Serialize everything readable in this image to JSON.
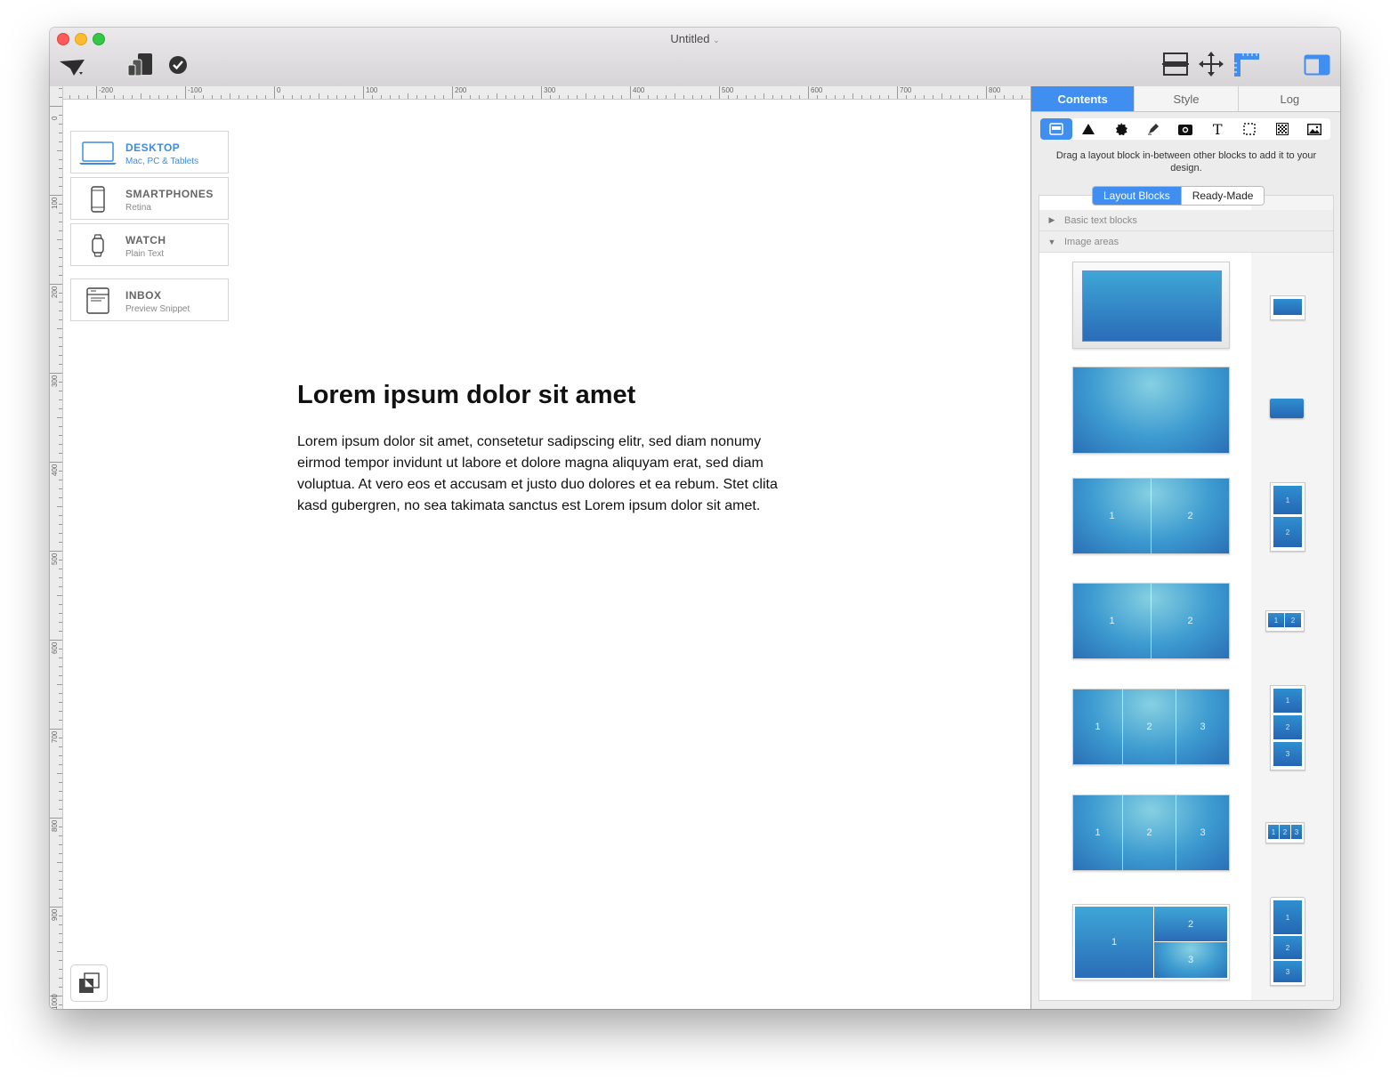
{
  "window": {
    "title": "Untitled"
  },
  "rulers": {
    "top_ticks": [
      "-200",
      "-100",
      "0",
      "100",
      "200",
      "300",
      "400",
      "500",
      "600",
      "700",
      "800"
    ],
    "left_ticks": [
      "0",
      "100",
      "200",
      "300",
      "400",
      "500",
      "600",
      "700",
      "800",
      "900",
      "1000"
    ]
  },
  "devices": [
    {
      "title": "DESKTOP",
      "subtitle": "Mac, PC & Tablets"
    },
    {
      "title": "SMARTPHONES",
      "subtitle": "Retina"
    },
    {
      "title": "WATCH",
      "subtitle": "Plain Text"
    },
    {
      "title": "INBOX",
      "subtitle": "Preview Snippet"
    }
  ],
  "document": {
    "heading": "Lorem ipsum dolor sit amet",
    "body": "Lorem ipsum dolor sit amet, consetetur sadipscing elitr, sed diam nonumy eirmod tempor invidunt ut labore et dolore magna aliquyam erat, sed diam voluptua. At vero eos et accusam et justo duo dolores et ea rebum. Stet clita kasd gubergren, no sea takimata sanctus est Lorem ipsum dolor sit amet."
  },
  "panel": {
    "tabs": [
      "Contents",
      "Style",
      "Log"
    ],
    "hint": "Drag a layout block in-between other blocks to add it to your design.",
    "segments": [
      "Layout Blocks",
      "Ready-Made"
    ],
    "groups": [
      "Basic text blocks",
      "Image areas"
    ],
    "cell_labels": {
      "one": "1",
      "two": "2",
      "three": "3"
    }
  },
  "icons": {
    "toolbar": [
      "send-icon",
      "devices-icon",
      "check-circle-icon",
      "layout-icon",
      "move-icon",
      "ruler-icon",
      "sidebar-icon"
    ],
    "tools": [
      "layout-block-icon",
      "triangle-icon",
      "badge-icon",
      "pen-icon",
      "camera-icon",
      "text-icon",
      "selection-icon",
      "pattern-icon",
      "image-icon"
    ]
  },
  "colors": {
    "accent": "#3f8ef0",
    "block_blue": "#2a6cb8"
  }
}
